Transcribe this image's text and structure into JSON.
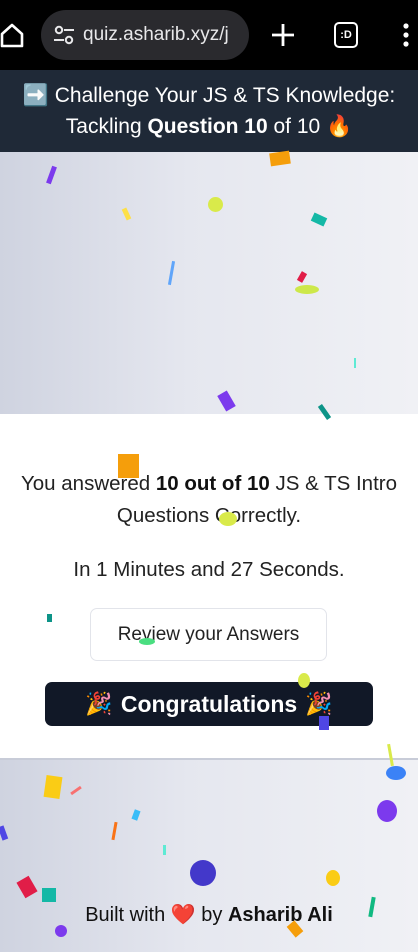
{
  "browser": {
    "url": "quiz.asharib.xyz/j",
    "tabs_label": ":D",
    "icons": [
      "home-icon",
      "tune-icon",
      "plus-icon",
      "tabs-icon",
      "menu-icon"
    ]
  },
  "header": {
    "arrow": "➡️",
    "line1": "Challenge Your JS & TS Knowledge:",
    "line2_prefix": "Tackling ",
    "line2_bold": "Question 10",
    "line2_suffix": " of 10 ",
    "fire": "🔥"
  },
  "result": {
    "score_prefix": "You answered ",
    "score_bold": "10 out of 10",
    "score_suffix": " JS & TS Intro",
    "score_line2": "Questions Correctly.",
    "time": "In 1 Minutes and 27 Seconds.",
    "review_button": "Review your Answers",
    "congrats": "Congratulations",
    "party": "🎉"
  },
  "footer": {
    "prefix": "Built with ",
    "heart": "❤️",
    "middle": " by ",
    "author": "Asharib Ali"
  },
  "colors": {
    "browser_bar": "#000000",
    "header_bg": "#1f2937",
    "badge_bg": "#111827"
  }
}
